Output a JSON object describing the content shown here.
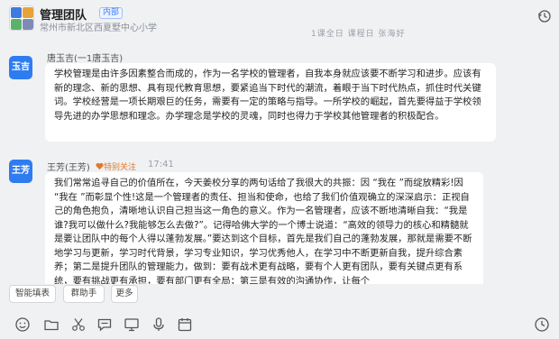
{
  "header": {
    "group_name": "管理团队",
    "tag": "内部",
    "subtitle": "常州市新北区西夏墅中心小学"
  },
  "snippet": "1课全日 课程日   张海好",
  "messages": [
    {
      "avatar": "玉吉",
      "sender": "唐玉吉(一1唐玉吉)",
      "text": "学校管理是由许多因素整合而成的，作为一名学校的管理者，自我本身就应该要不断学习和进步。应该有新的理念、新的思想、具有现代教育思想，要紧追当下时代的潮流，着眼于当下时代热点，抓住时代关键词。学校经营是一项长期艰巨的任务，需要有一定的策略与指导。一所学校的崛起，首先要得益于学校领导先进的办学思想和理念。办学理念是学校的灵魂，同时也得力于学校其他管理者的积极配合。"
    },
    {
      "avatar": "王芳",
      "sender": "王芳(王芳)",
      "badge": "特别关注",
      "time": "17:41",
      "text": "我们常常追寻自己的价值所在，今天姜校分享的两句话给了我很大的共振：因 “我在 ”而绽放精彩!因 “我在 ”而彰显个性!这是一个管理者的责任、担当和使命，也给了我们价值观确立的深深启示：正视自己的角色抱负，清晰地认识自己担当这一角色的意义。作为一名管理者，应该不断地清晰自我：“我是谁?我可以做什么?我能够怎么去做?”。记得哈佛大学的一个博士说道：“高效的领导力的核心和精髓就是要让团队中的每个人得以蓬勃发展。”要达到这个目标，首先是我们自己的蓬勃发展，那就是需要不断地学习与更新，学习时代背景，学习专业知识，学习优秀他人，在学习中不断更新自我，提升综合素养；第二是提升团队的管理能力，做到：要有战术更有战略，要有个人更有团队，要有关键点更有系统，要有挑战更有承担，要有部门更有全局；第三是有效的沟通协作，让每个"
    }
  ],
  "quick_actions": [
    "智能填表",
    "群助手",
    "更多"
  ],
  "toolbar_icons": [
    "emoji-icon",
    "folder-icon",
    "scissors-icon",
    "chat-record-icon",
    "screen-share-icon",
    "mic-icon",
    "calendar-icon",
    "history-clock-icon"
  ]
}
